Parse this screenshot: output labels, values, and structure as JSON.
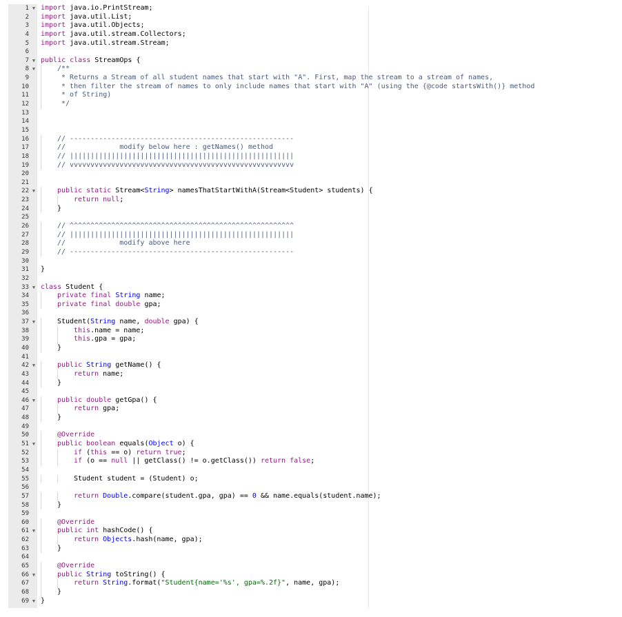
{
  "editor": {
    "lines": [
      {
        "n": "1",
        "fold": true,
        "indent": 0,
        "tokens": [
          [
            "kw",
            "import"
          ],
          [
            "t",
            " java.io.PrintStream;"
          ]
        ]
      },
      {
        "n": "2",
        "fold": false,
        "indent": 0,
        "tokens": [
          [
            "kw",
            "import"
          ],
          [
            "t",
            " java.util.List;"
          ]
        ]
      },
      {
        "n": "3",
        "fold": false,
        "indent": 0,
        "tokens": [
          [
            "kw",
            "import"
          ],
          [
            "t",
            " java.util.Objects;"
          ]
        ]
      },
      {
        "n": "4",
        "fold": false,
        "indent": 0,
        "tokens": [
          [
            "kw",
            "import"
          ],
          [
            "t",
            " java.util.stream.Collectors;"
          ]
        ]
      },
      {
        "n": "5",
        "fold": false,
        "indent": 0,
        "tokens": [
          [
            "kw",
            "import"
          ],
          [
            "t",
            " java.util.stream.Stream;"
          ]
        ]
      },
      {
        "n": "6",
        "fold": false,
        "indent": 0,
        "tokens": []
      },
      {
        "n": "7",
        "fold": true,
        "indent": 0,
        "tokens": [
          [
            "kw",
            "public class"
          ],
          [
            "t",
            " StreamOps {"
          ]
        ]
      },
      {
        "n": "8",
        "fold": true,
        "indent": 1,
        "tokens": [
          [
            "cm",
            "/**"
          ]
        ]
      },
      {
        "n": "9",
        "fold": false,
        "indent": 1,
        "tokens": [
          [
            "cm",
            " * Returns a Stream of all student names that start with \"A\". First, map the stream to a stream of names,"
          ]
        ]
      },
      {
        "n": "10",
        "fold": false,
        "indent": 1,
        "tokens": [
          [
            "cm",
            " * then filter the stream of names to only include names that start with \"A\" (using the {@code startsWith()} method"
          ]
        ]
      },
      {
        "n": "11",
        "fold": false,
        "indent": 1,
        "tokens": [
          [
            "cm",
            " * of String)"
          ]
        ]
      },
      {
        "n": "12",
        "fold": false,
        "indent": 1,
        "tokens": [
          [
            "cm",
            " */"
          ]
        ]
      },
      {
        "n": "13",
        "fold": false,
        "indent": 0,
        "tokens": []
      },
      {
        "n": "14",
        "fold": false,
        "indent": 0,
        "tokens": []
      },
      {
        "n": "15",
        "fold": false,
        "indent": 0,
        "tokens": []
      },
      {
        "n": "16",
        "fold": false,
        "indent": 1,
        "tokens": [
          [
            "cm",
            "// ------------------------------------------------------"
          ]
        ]
      },
      {
        "n": "17",
        "fold": false,
        "indent": 1,
        "tokens": [
          [
            "cm",
            "//             modify below here : getNames() method"
          ]
        ]
      },
      {
        "n": "18",
        "fold": false,
        "indent": 1,
        "tokens": [
          [
            "cm",
            "// ||||||||||||||||||||||||||||||||||||||||||||||||||||||"
          ]
        ]
      },
      {
        "n": "19",
        "fold": false,
        "indent": 1,
        "tokens": [
          [
            "cm",
            "// vvvvvvvvvvvvvvvvvvvvvvvvvvvvvvvvvvvvvvvvvvvvvvvvvvvvvv"
          ]
        ]
      },
      {
        "n": "20",
        "fold": false,
        "indent": 0,
        "tokens": []
      },
      {
        "n": "21",
        "fold": false,
        "indent": 0,
        "tokens": []
      },
      {
        "n": "22",
        "fold": true,
        "indent": 1,
        "tokens": [
          [
            "kw",
            "public static"
          ],
          [
            "t",
            " Stream<"
          ],
          [
            "ty",
            "String"
          ],
          [
            "t",
            "> namesThatStartWithA(Stream<Student> students) {"
          ]
        ]
      },
      {
        "n": "23",
        "fold": false,
        "indent": 2,
        "tokens": [
          [
            "kw",
            "return null"
          ],
          [
            "t",
            ";"
          ]
        ]
      },
      {
        "n": "24",
        "fold": false,
        "indent": 1,
        "tokens": [
          [
            "t",
            "}"
          ]
        ]
      },
      {
        "n": "25",
        "fold": false,
        "indent": 0,
        "tokens": []
      },
      {
        "n": "26",
        "fold": false,
        "indent": 1,
        "tokens": [
          [
            "cm",
            "// ^^^^^^^^^^^^^^^^^^^^^^^^^^^^^^^^^^^^^^^^^^^^^^^^^^^^^^"
          ]
        ]
      },
      {
        "n": "27",
        "fold": false,
        "indent": 1,
        "tokens": [
          [
            "cm",
            "// ||||||||||||||||||||||||||||||||||||||||||||||||||||||"
          ]
        ]
      },
      {
        "n": "28",
        "fold": false,
        "indent": 1,
        "tokens": [
          [
            "cm",
            "//             modify above here"
          ]
        ]
      },
      {
        "n": "29",
        "fold": false,
        "indent": 1,
        "tokens": [
          [
            "cm",
            "// ------------------------------------------------------"
          ]
        ]
      },
      {
        "n": "30",
        "fold": false,
        "indent": 0,
        "tokens": []
      },
      {
        "n": "31",
        "fold": false,
        "indent": 0,
        "tokens": [
          [
            "t",
            "}"
          ]
        ]
      },
      {
        "n": "32",
        "fold": false,
        "indent": 0,
        "tokens": []
      },
      {
        "n": "33",
        "fold": true,
        "indent": 0,
        "tokens": [
          [
            "kw",
            "class"
          ],
          [
            "t",
            " Student {"
          ]
        ]
      },
      {
        "n": "34",
        "fold": false,
        "indent": 1,
        "tokens": [
          [
            "kw",
            "private final"
          ],
          [
            "t",
            " "
          ],
          [
            "ty",
            "String"
          ],
          [
            "t",
            " name;"
          ]
        ]
      },
      {
        "n": "35",
        "fold": false,
        "indent": 1,
        "tokens": [
          [
            "kw",
            "private final double"
          ],
          [
            "t",
            " gpa;"
          ]
        ]
      },
      {
        "n": "36",
        "fold": false,
        "indent": 0,
        "tokens": []
      },
      {
        "n": "37",
        "fold": true,
        "indent": 1,
        "tokens": [
          [
            "t",
            "Student("
          ],
          [
            "ty",
            "String"
          ],
          [
            "t",
            " name, "
          ],
          [
            "kw",
            "double"
          ],
          [
            "t",
            " gpa) {"
          ]
        ]
      },
      {
        "n": "38",
        "fold": false,
        "indent": 2,
        "tokens": [
          [
            "kw",
            "this"
          ],
          [
            "t",
            ".name = name;"
          ]
        ]
      },
      {
        "n": "39",
        "fold": false,
        "indent": 2,
        "tokens": [
          [
            "kw",
            "this"
          ],
          [
            "t",
            ".gpa = gpa;"
          ]
        ]
      },
      {
        "n": "40",
        "fold": false,
        "indent": 1,
        "tokens": [
          [
            "t",
            "}"
          ]
        ]
      },
      {
        "n": "41",
        "fold": false,
        "indent": 0,
        "tokens": []
      },
      {
        "n": "42",
        "fold": true,
        "indent": 1,
        "tokens": [
          [
            "kw",
            "public"
          ],
          [
            "t",
            " "
          ],
          [
            "ty",
            "String"
          ],
          [
            "t",
            " getName() {"
          ]
        ]
      },
      {
        "n": "43",
        "fold": false,
        "indent": 2,
        "tokens": [
          [
            "kw",
            "return"
          ],
          [
            "t",
            " name;"
          ]
        ]
      },
      {
        "n": "44",
        "fold": false,
        "indent": 1,
        "tokens": [
          [
            "t",
            "}"
          ]
        ]
      },
      {
        "n": "45",
        "fold": false,
        "indent": 0,
        "tokens": []
      },
      {
        "n": "46",
        "fold": true,
        "indent": 1,
        "tokens": [
          [
            "kw",
            "public double"
          ],
          [
            "t",
            " getGpa() {"
          ]
        ]
      },
      {
        "n": "47",
        "fold": false,
        "indent": 2,
        "tokens": [
          [
            "kw",
            "return"
          ],
          [
            "t",
            " gpa;"
          ]
        ]
      },
      {
        "n": "48",
        "fold": false,
        "indent": 1,
        "tokens": [
          [
            "t",
            "}"
          ]
        ]
      },
      {
        "n": "49",
        "fold": false,
        "indent": 0,
        "tokens": []
      },
      {
        "n": "50",
        "fold": false,
        "indent": 1,
        "tokens": [
          [
            "ann",
            "@Override"
          ]
        ]
      },
      {
        "n": "51",
        "fold": true,
        "indent": 1,
        "tokens": [
          [
            "kw",
            "public boolean"
          ],
          [
            "t",
            " equals("
          ],
          [
            "ty",
            "Object"
          ],
          [
            "t",
            " o) {"
          ]
        ]
      },
      {
        "n": "52",
        "fold": false,
        "indent": 2,
        "tokens": [
          [
            "kw",
            "if"
          ],
          [
            "t",
            " ("
          ],
          [
            "kw",
            "this"
          ],
          [
            "t",
            " == o) "
          ],
          [
            "kw",
            "return true"
          ],
          [
            "t",
            ";"
          ]
        ]
      },
      {
        "n": "53",
        "fold": false,
        "indent": 2,
        "tokens": [
          [
            "kw",
            "if"
          ],
          [
            "t",
            " (o == "
          ],
          [
            "kw",
            "null"
          ],
          [
            "t",
            " || getClass() != o.getClass()) "
          ],
          [
            "kw",
            "return false"
          ],
          [
            "t",
            ";"
          ]
        ]
      },
      {
        "n": "54",
        "fold": false,
        "indent": 0,
        "tokens": []
      },
      {
        "n": "55",
        "fold": false,
        "indent": 2,
        "tokens": [
          [
            "t",
            "Student student = (Student) o;"
          ]
        ]
      },
      {
        "n": "56",
        "fold": false,
        "indent": 0,
        "tokens": []
      },
      {
        "n": "57",
        "fold": false,
        "indent": 2,
        "tokens": [
          [
            "kw",
            "return"
          ],
          [
            "t",
            " "
          ],
          [
            "ty",
            "Double"
          ],
          [
            "t",
            ".compare(student.gpa, gpa) == "
          ],
          [
            "num",
            "0"
          ],
          [
            "t",
            " && name.equals(student.name);"
          ]
        ]
      },
      {
        "n": "58",
        "fold": false,
        "indent": 1,
        "tokens": [
          [
            "t",
            "}"
          ]
        ]
      },
      {
        "n": "59",
        "fold": false,
        "indent": 0,
        "tokens": []
      },
      {
        "n": "60",
        "fold": false,
        "indent": 1,
        "tokens": [
          [
            "ann",
            "@Override"
          ]
        ]
      },
      {
        "n": "61",
        "fold": true,
        "indent": 1,
        "tokens": [
          [
            "kw",
            "public int"
          ],
          [
            "t",
            " hashCode() {"
          ]
        ]
      },
      {
        "n": "62",
        "fold": false,
        "indent": 2,
        "tokens": [
          [
            "kw",
            "return"
          ],
          [
            "t",
            " "
          ],
          [
            "ty",
            "Objects"
          ],
          [
            "t",
            ".hash(name, gpa);"
          ]
        ]
      },
      {
        "n": "63",
        "fold": false,
        "indent": 1,
        "tokens": [
          [
            "t",
            "}"
          ]
        ]
      },
      {
        "n": "64",
        "fold": false,
        "indent": 0,
        "tokens": []
      },
      {
        "n": "65",
        "fold": false,
        "indent": 1,
        "tokens": [
          [
            "ann",
            "@Override"
          ]
        ]
      },
      {
        "n": "66",
        "fold": true,
        "indent": 1,
        "tokens": [
          [
            "kw",
            "public"
          ],
          [
            "t",
            " "
          ],
          [
            "ty",
            "String"
          ],
          [
            "t",
            " toString() {"
          ]
        ]
      },
      {
        "n": "67",
        "fold": false,
        "indent": 2,
        "tokens": [
          [
            "kw",
            "return"
          ],
          [
            "t",
            " "
          ],
          [
            "ty",
            "String"
          ],
          [
            "t",
            ".format("
          ],
          [
            "str",
            "\"Student{name='%s', gpa=%.2f}\""
          ],
          [
            "t",
            ", name, gpa);"
          ]
        ]
      },
      {
        "n": "68",
        "fold": false,
        "indent": 1,
        "tokens": [
          [
            "t",
            "}"
          ]
        ]
      },
      {
        "n": "69",
        "fold": true,
        "indent": 0,
        "tokens": [
          [
            "t",
            "}"
          ]
        ]
      }
    ]
  }
}
